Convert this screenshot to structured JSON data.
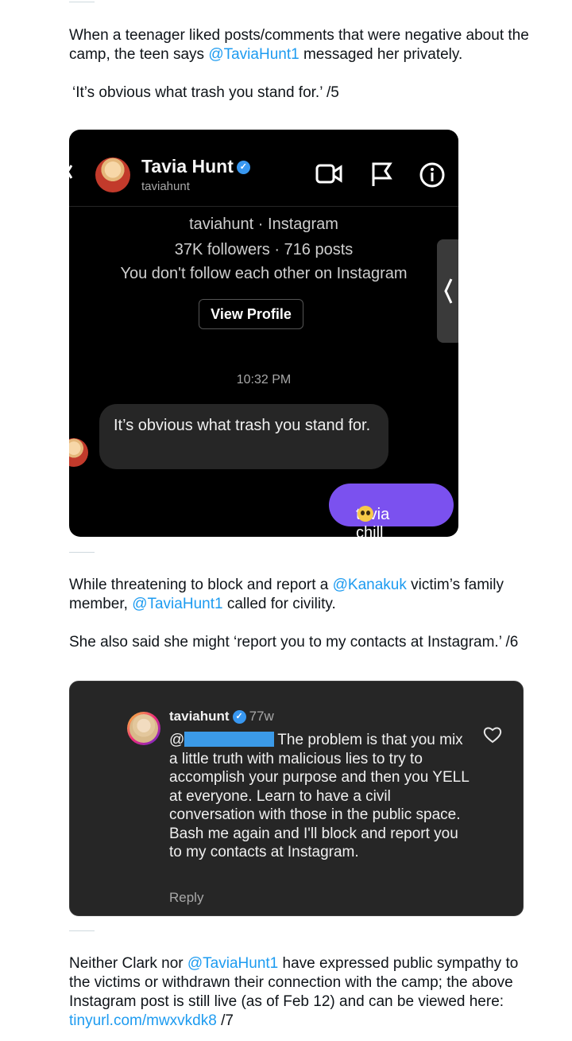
{
  "tweet5": {
    "text_before": "When a teenager liked posts/comments that were negative about the camp, the teen says ",
    "mention": "@TaviaHunt1",
    "text_after": " messaged her privately.",
    "quote": "‘It’s obvious what trash you stand for.’ /5"
  },
  "dm": {
    "header_name": "Tavia Hunt",
    "header_username": "taviahunt",
    "profile_line": "taviahunt · Instagram",
    "stats_line": "37K followers · 716 posts",
    "follow_status": "You don't follow each other on Instagram",
    "view_profile": "View Profile",
    "timestamp": "10:32 PM",
    "incoming_message": "It’s obvious what trash you stand for.",
    "outgoing_message": "tavia chill"
  },
  "tweet6": {
    "text1": "While threatening to block and report a ",
    "mention1": "@Kanakuk",
    "text2": " victim’s family member, ",
    "mention2": "@TaviaHunt1",
    "text3": " called for civility.",
    "para2": "She also said she might ‘report you to my contacts at Instagram.’ /6"
  },
  "comment": {
    "username": "taviahunt",
    "age": "77w",
    "at": "@",
    "text": "The problem is that you mix a little truth with malicious lies to try to accomplish your purpose and then you YELL at everyone. Learn to have a civil conversation with those in the public space. Bash me again and I'll block and report you to my contacts at Instagram.",
    "reply": "Reply"
  },
  "tweet7": {
    "text1": "Neither Clark nor ",
    "mention": "@TaviaHunt1",
    "text2": " have expressed public sympathy to the victims or withdrawn their connection with the camp; the above Instagram post is still live (as of Feb 12) and can be viewed here: ",
    "link": "tinyurl.com/mwxvkdk8",
    "text3": " /7"
  }
}
